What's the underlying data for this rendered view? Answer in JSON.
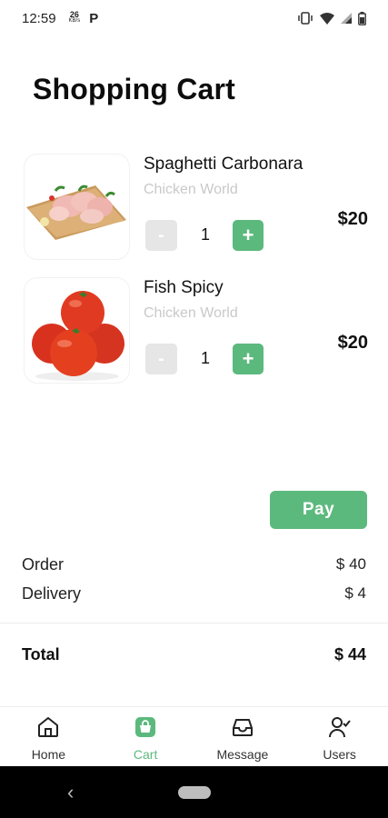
{
  "status_bar": {
    "time": "12:59",
    "speed_value": "26",
    "speed_unit": "KB/s",
    "app_icon_letter": "P"
  },
  "page": {
    "title": "Shopping Cart"
  },
  "cart": {
    "items": [
      {
        "name": "Spaghetti Carbonara",
        "vendor": "Chicken World",
        "minus": "-",
        "quantity": "1",
        "plus": "+",
        "price": "$20",
        "image": "raw-chicken-on-board"
      },
      {
        "name": "Fish Spicy",
        "vendor": "Chicken World",
        "minus": "-",
        "quantity": "1",
        "plus": "+",
        "price": "$20",
        "image": "tomatoes"
      }
    ]
  },
  "actions": {
    "pay_label": "Pay"
  },
  "summary": {
    "order_label": "Order",
    "order_value": "$ 40",
    "delivery_label": "Delivery",
    "delivery_value": "$ 4",
    "total_label": "Total",
    "total_value": "$ 44"
  },
  "bottom_nav": {
    "items": [
      {
        "label": "Home",
        "icon": "home-icon",
        "active": false
      },
      {
        "label": "Cart",
        "icon": "cart-icon",
        "active": true
      },
      {
        "label": "Message",
        "icon": "inbox-icon",
        "active": false
      },
      {
        "label": "Users",
        "icon": "user-check-icon",
        "active": false
      }
    ]
  },
  "colors": {
    "accent": "#5cb97d",
    "muted_button": "#e6e6e6",
    "vendor_text": "#c9c9c9"
  }
}
